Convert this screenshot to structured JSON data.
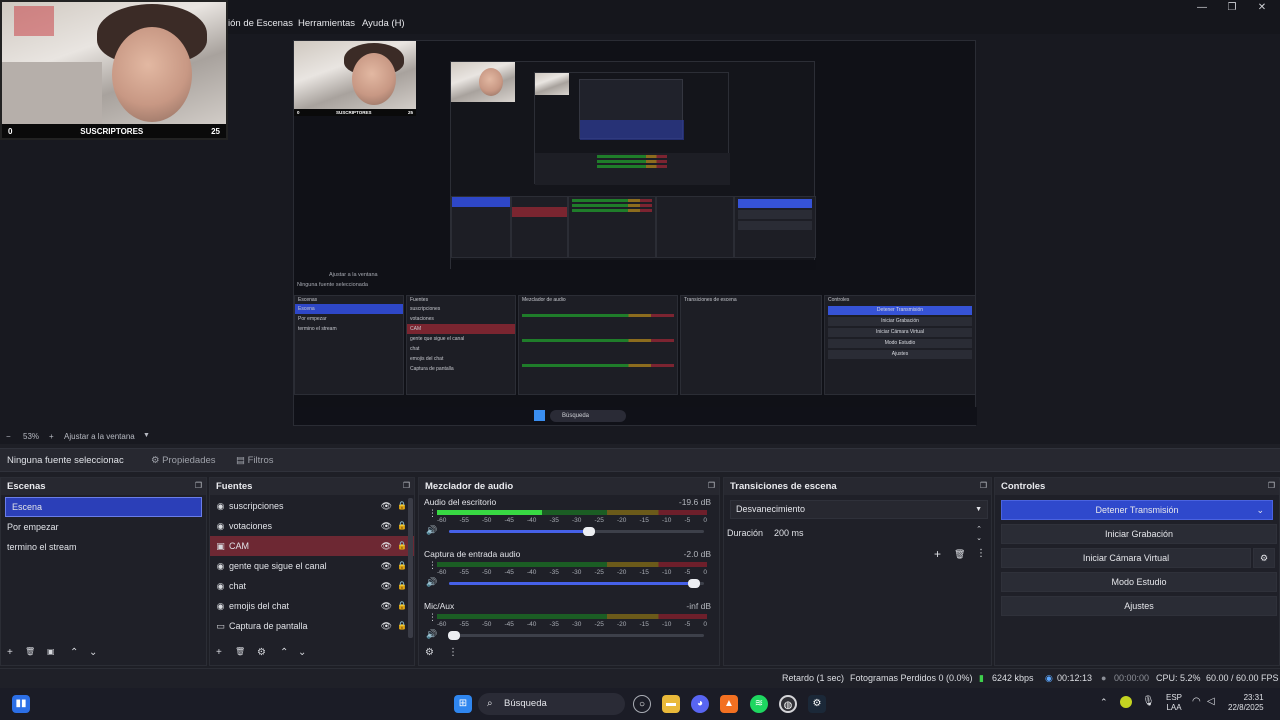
{
  "menubar": {
    "partial_menu": "ión de Escenas",
    "tools": "Herramientas",
    "help": "Ayuda (H)",
    "minimize": "—",
    "maximize": "❐",
    "close": "✕"
  },
  "webcam_overlay": {
    "left_count": "0",
    "label": "SUSCRIPTORES",
    "right_count": "25"
  },
  "zoom": {
    "minus": "−",
    "level": "53%",
    "plus": "+",
    "fit_label": "Ajustar a la ventana",
    "dropdown_arrow": "▼"
  },
  "source_bar": {
    "no_source": "Ninguna fuente seleccionac",
    "properties": "Propiedades",
    "filters": "Filtros",
    "properties_icon": "⚙",
    "filters_icon": "▤"
  },
  "scenes": {
    "title": "Escenas",
    "items": [
      "Escena",
      "Por empezar",
      "termino el stream"
    ],
    "footer": [
      "+",
      "🗑",
      "▣",
      "⌃",
      "⌄"
    ]
  },
  "sources": {
    "title": "Fuentes",
    "items": [
      {
        "icon": "◉",
        "label": "suscripciones"
      },
      {
        "icon": "◉",
        "label": "votaciones"
      },
      {
        "icon": "▣",
        "label": "CAM"
      },
      {
        "icon": "◉",
        "label": "gente que sigue el canal"
      },
      {
        "icon": "◉",
        "label": "chat"
      },
      {
        "icon": "◉",
        "label": "emojis del chat"
      },
      {
        "icon": "▭",
        "label": "Captura de pantalla"
      }
    ],
    "eye": "👁",
    "lock": "🔒",
    "footer": [
      "+",
      "🗑",
      "⚙",
      "⌃",
      "⌄"
    ]
  },
  "mixer": {
    "title": "Mezclador de audio",
    "ticks": [
      "-60",
      "-55",
      "-50",
      "-45",
      "-40",
      "-35",
      "-30",
      "-25",
      "-20",
      "-15",
      "-10",
      "-5",
      "0"
    ],
    "channels": [
      {
        "name": "Audio del escritorio",
        "db": "-19.6 dB",
        "level": 0.39,
        "volume": 0.55
      },
      {
        "name": "Captura de entrada audio",
        "db": "-2.0 dB",
        "level": 0.0,
        "volume": 0.96
      },
      {
        "name": "Mic/Aux",
        "db": "-inf dB",
        "level": 0.0,
        "volume": 0.02
      }
    ],
    "footer": [
      "⚙",
      "⋮"
    ]
  },
  "transitions": {
    "title": "Transiciones de escena",
    "selected": "Desvanecimiento",
    "duration_label": "Duración",
    "duration_value": "200 ms",
    "add": "+",
    "remove": "🗑",
    "more": "⋮"
  },
  "controls": {
    "title": "Controles",
    "stop_stream": "Detener Transmisión",
    "start_recording": "Iniciar Grabación",
    "start_virtual_cam": "Iniciar Cámara Virtual",
    "studio_mode": "Modo Estudio",
    "settings": "Ajustes",
    "gear": "⚙",
    "chevron": "⌄"
  },
  "status": {
    "delay": "Retardo (1 sec)",
    "dropped": "Fotogramas Perdidos 0 (0.0%)",
    "bitrate": "6242 kbps",
    "stream_time": "00:12:13",
    "rec_time": "00:00:00",
    "cpu": "CPU: 5.2%",
    "fps": "60.00 / 60.00 FPS"
  },
  "taskbar": {
    "search": "Búsqueda",
    "lang1": "ESP",
    "lang2": "LAA",
    "time": "23:31",
    "date": "22/8/2025"
  },
  "nested_preview": {
    "scenes_title": "Escenas",
    "sources_title": "Fuentes",
    "mixer_title": "Mezclador de audio",
    "trans_title": "Transiciones de escena",
    "controls_title": "Controles",
    "scene_items": [
      "Escena",
      "Por empezar",
      "termino el stream"
    ],
    "source_items": [
      "suscripciones",
      "votaciones",
      "CAM",
      "gente que sigue el canal",
      "chat",
      "emojis del chat",
      "Captura de pantalla"
    ],
    "no_source": "Ninguna fuente seleccionada",
    "fit_label": "Ajustar a la ventana",
    "search": "Búsqueda"
  }
}
